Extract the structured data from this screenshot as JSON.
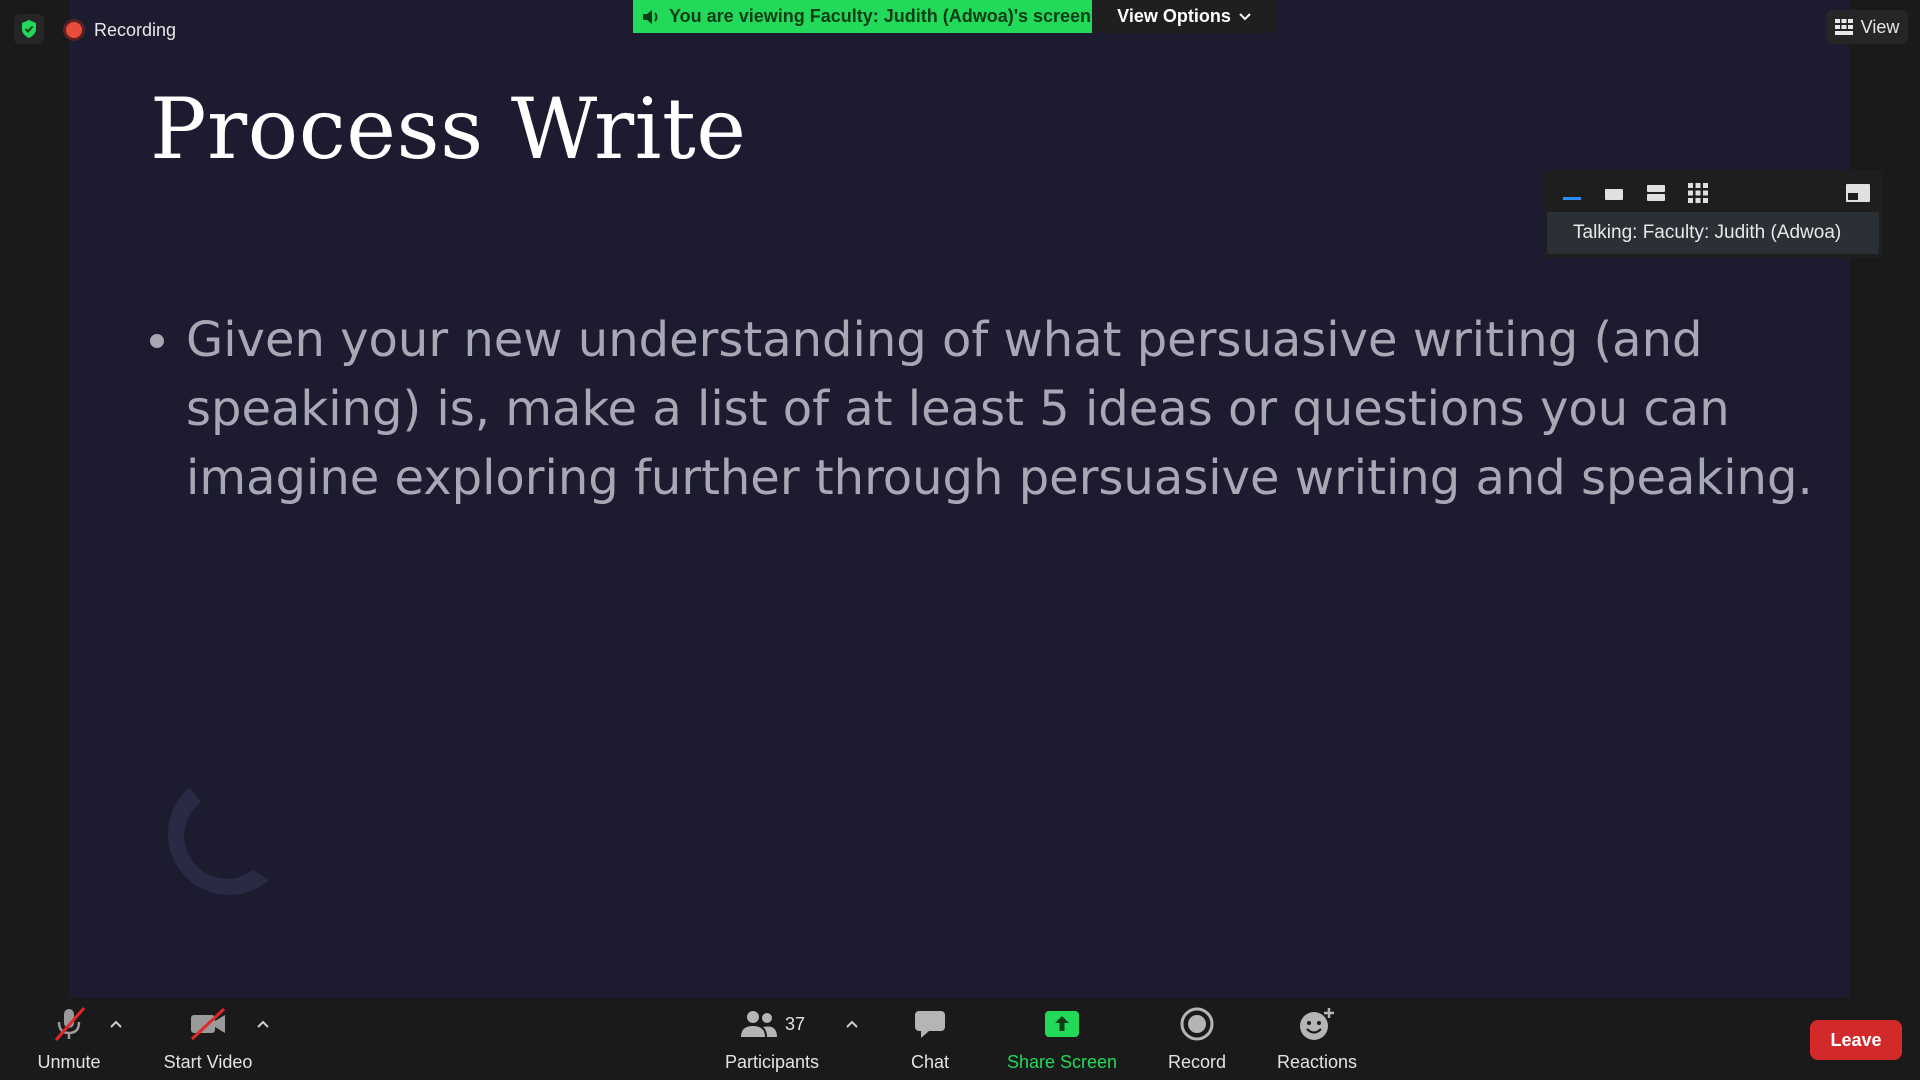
{
  "status": {
    "recording_label": "Recording",
    "viewing_banner": "You are viewing Faculty: Judith (Adwoa)'s screen",
    "view_options_label": "View Options",
    "view_label": "View"
  },
  "slide": {
    "title": "Process Write",
    "bullet": "Given your new understanding of what persuasive writing (and speaking) is, make a list of at least 5 ideas or questions you can imagine exploring further through persuasive writing and speaking."
  },
  "speaker_panel": {
    "talking": "Talking: Faculty: Judith (Adwoa)",
    "layout_icons": [
      "minimize-icon",
      "speaker-view-icon",
      "side-by-side-icon",
      "gallery-grid-icon",
      "exit-split-icon"
    ]
  },
  "toolbar": {
    "unmute": "Unmute",
    "start_video": "Start Video",
    "participants": "Participants",
    "participants_count": "37",
    "chat": "Chat",
    "share_screen": "Share Screen",
    "record": "Record",
    "reactions": "Reactions",
    "leave": "Leave"
  },
  "colors": {
    "slide_bg": "#1c1b2f",
    "accent_green": "#23d959",
    "leave_red": "#d22a2a"
  }
}
